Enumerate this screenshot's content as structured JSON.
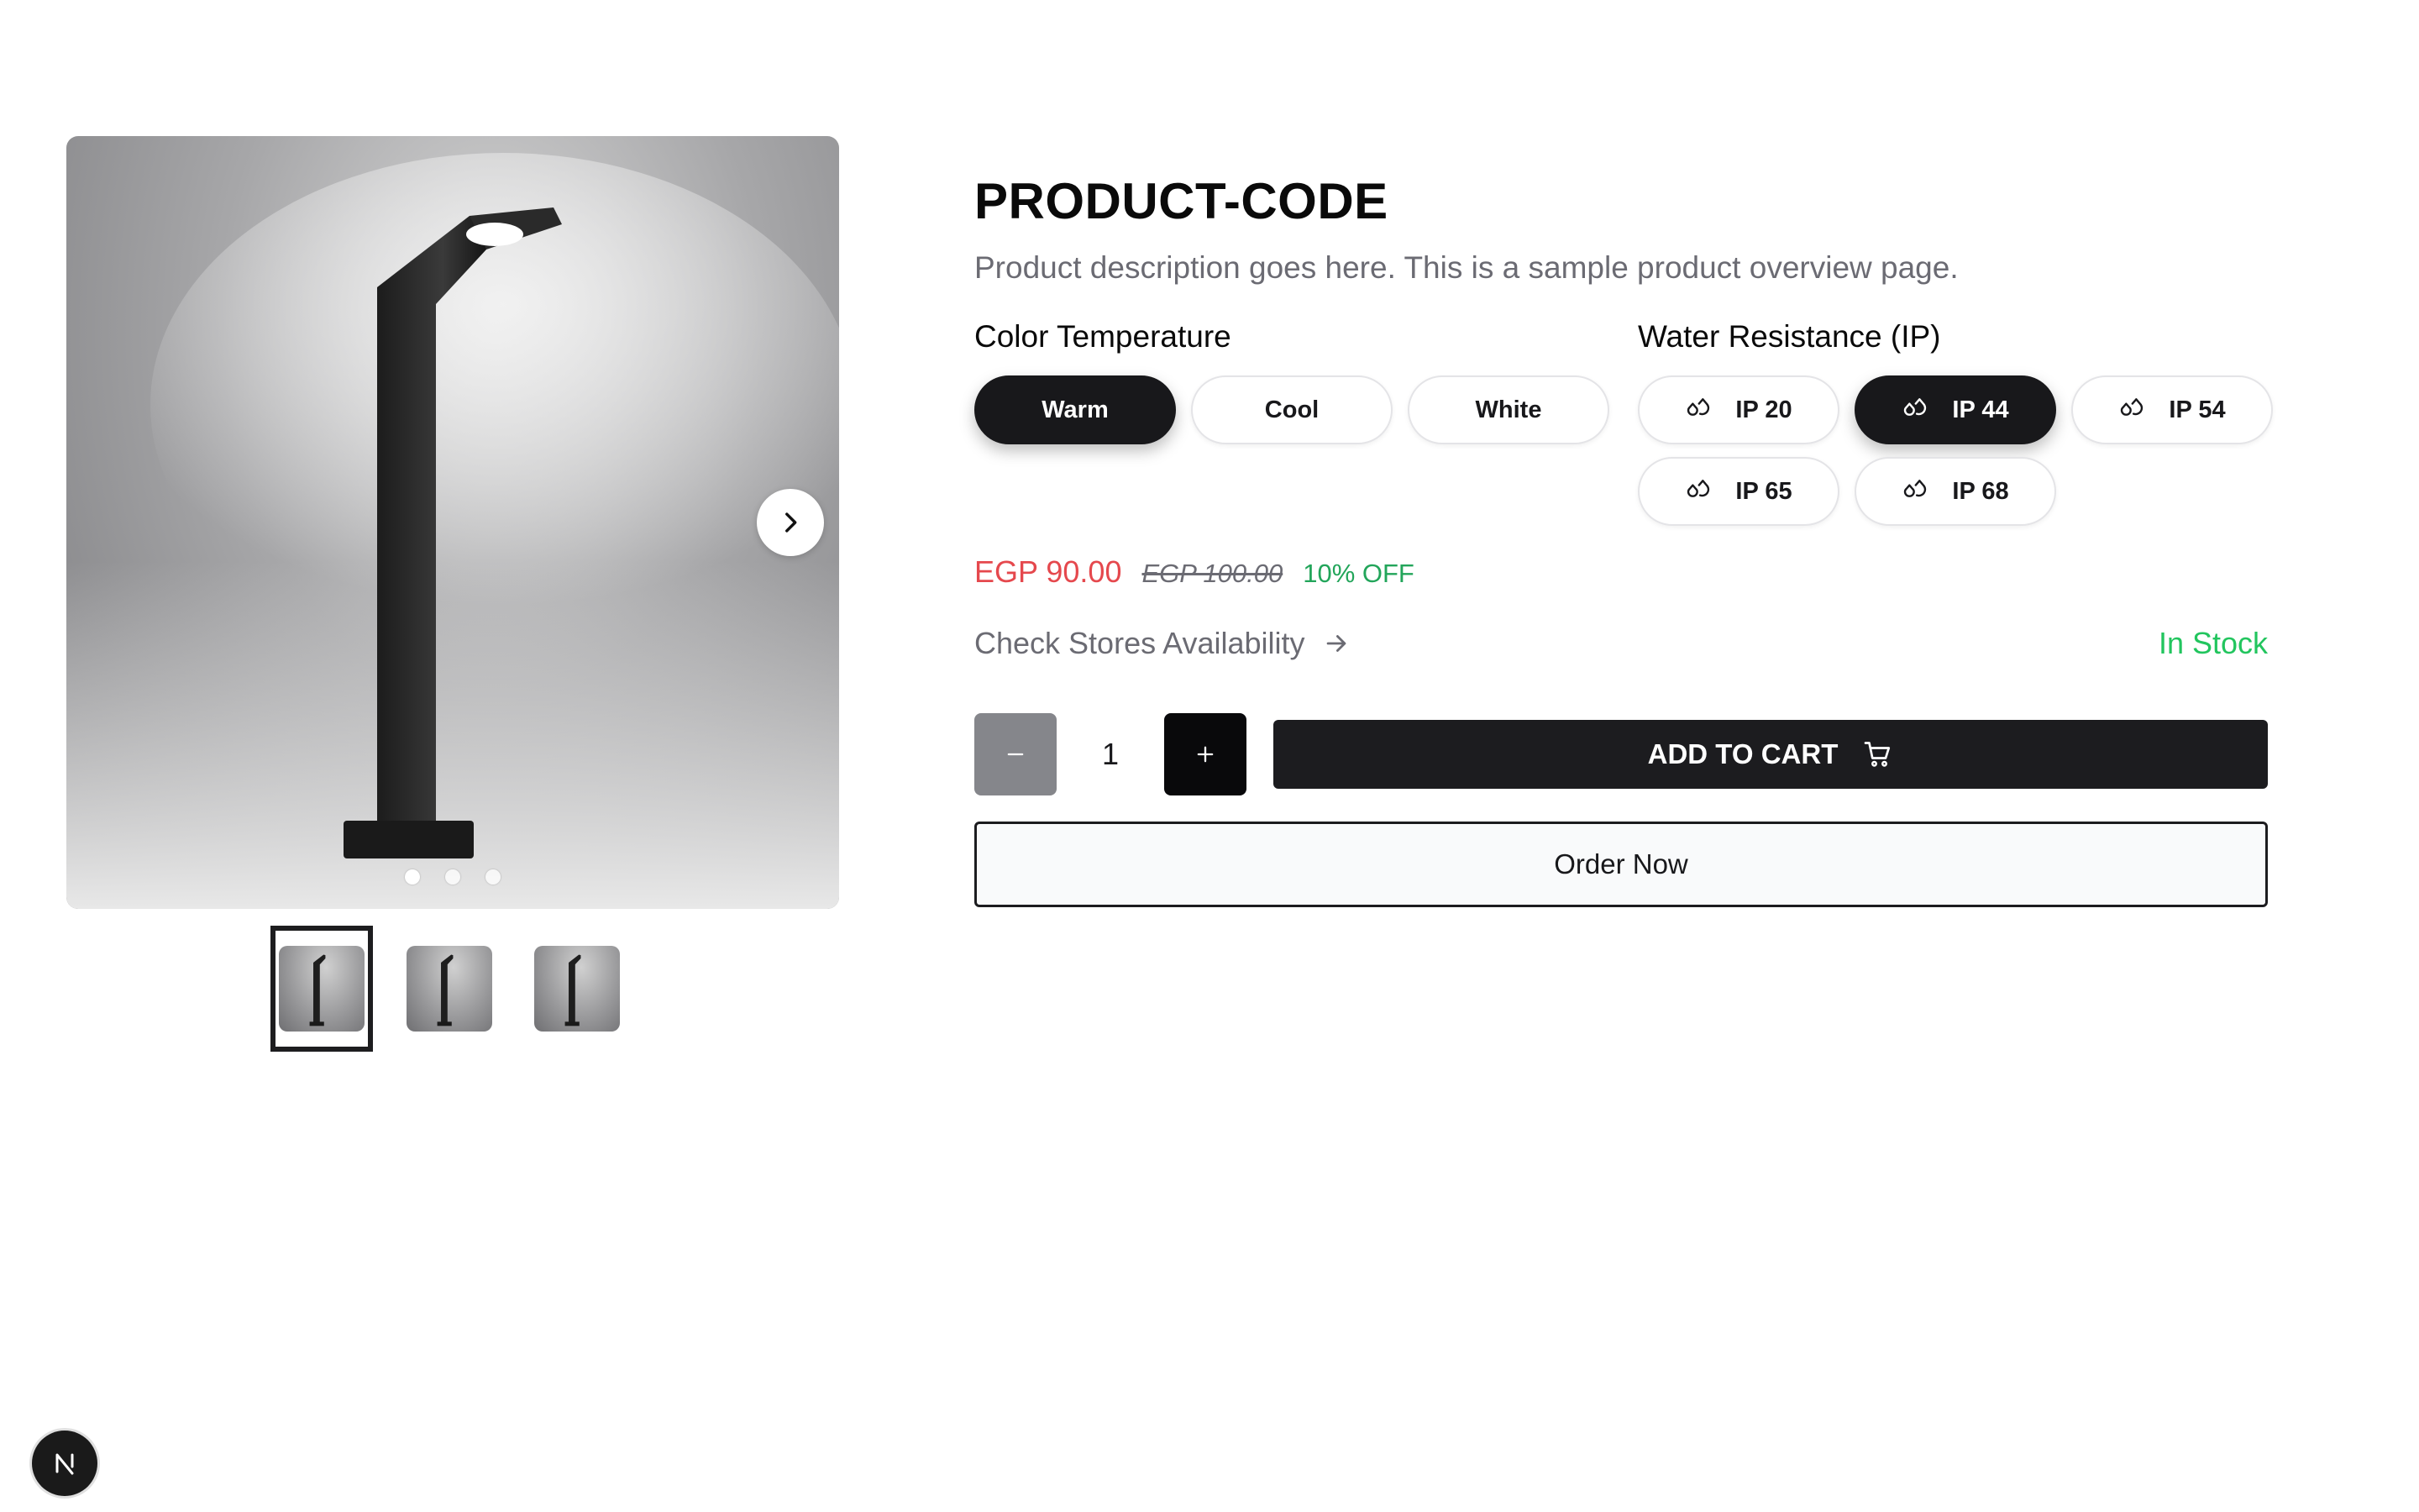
{
  "product": {
    "title": "PRODUCT-CODE",
    "description": "Product description goes here. This is a sample product overview page."
  },
  "gallery": {
    "image_count": 3,
    "active_index": 0,
    "next_icon": "chevron-right-icon"
  },
  "options": {
    "color_temperature": {
      "label": "Color Temperature",
      "choices": [
        "Warm",
        "Cool",
        "White"
      ],
      "selected": "Warm"
    },
    "water_resistance": {
      "label": "Water Resistance (IP)",
      "choices": [
        "IP 20",
        "IP 44",
        "IP 54",
        "IP 65",
        "IP 68"
      ],
      "selected": "IP 44",
      "icon": "droplets-icon"
    }
  },
  "pricing": {
    "current": "EGP 90.00",
    "original": "EGP 100.00",
    "discount": "10% OFF"
  },
  "availability": {
    "stores_link": "Check Stores Availability",
    "stock_status": "In Stock"
  },
  "cart": {
    "quantity": "1",
    "add_to_cart_label": "ADD TO CART",
    "order_now_label": "Order Now"
  },
  "colors": {
    "primary": "#18181b",
    "sale_price": "#e5484d",
    "discount": "#22a55a",
    "in_stock": "#22c55e",
    "muted": "#6b6b73"
  },
  "dev_badge": {
    "letter": "N"
  }
}
